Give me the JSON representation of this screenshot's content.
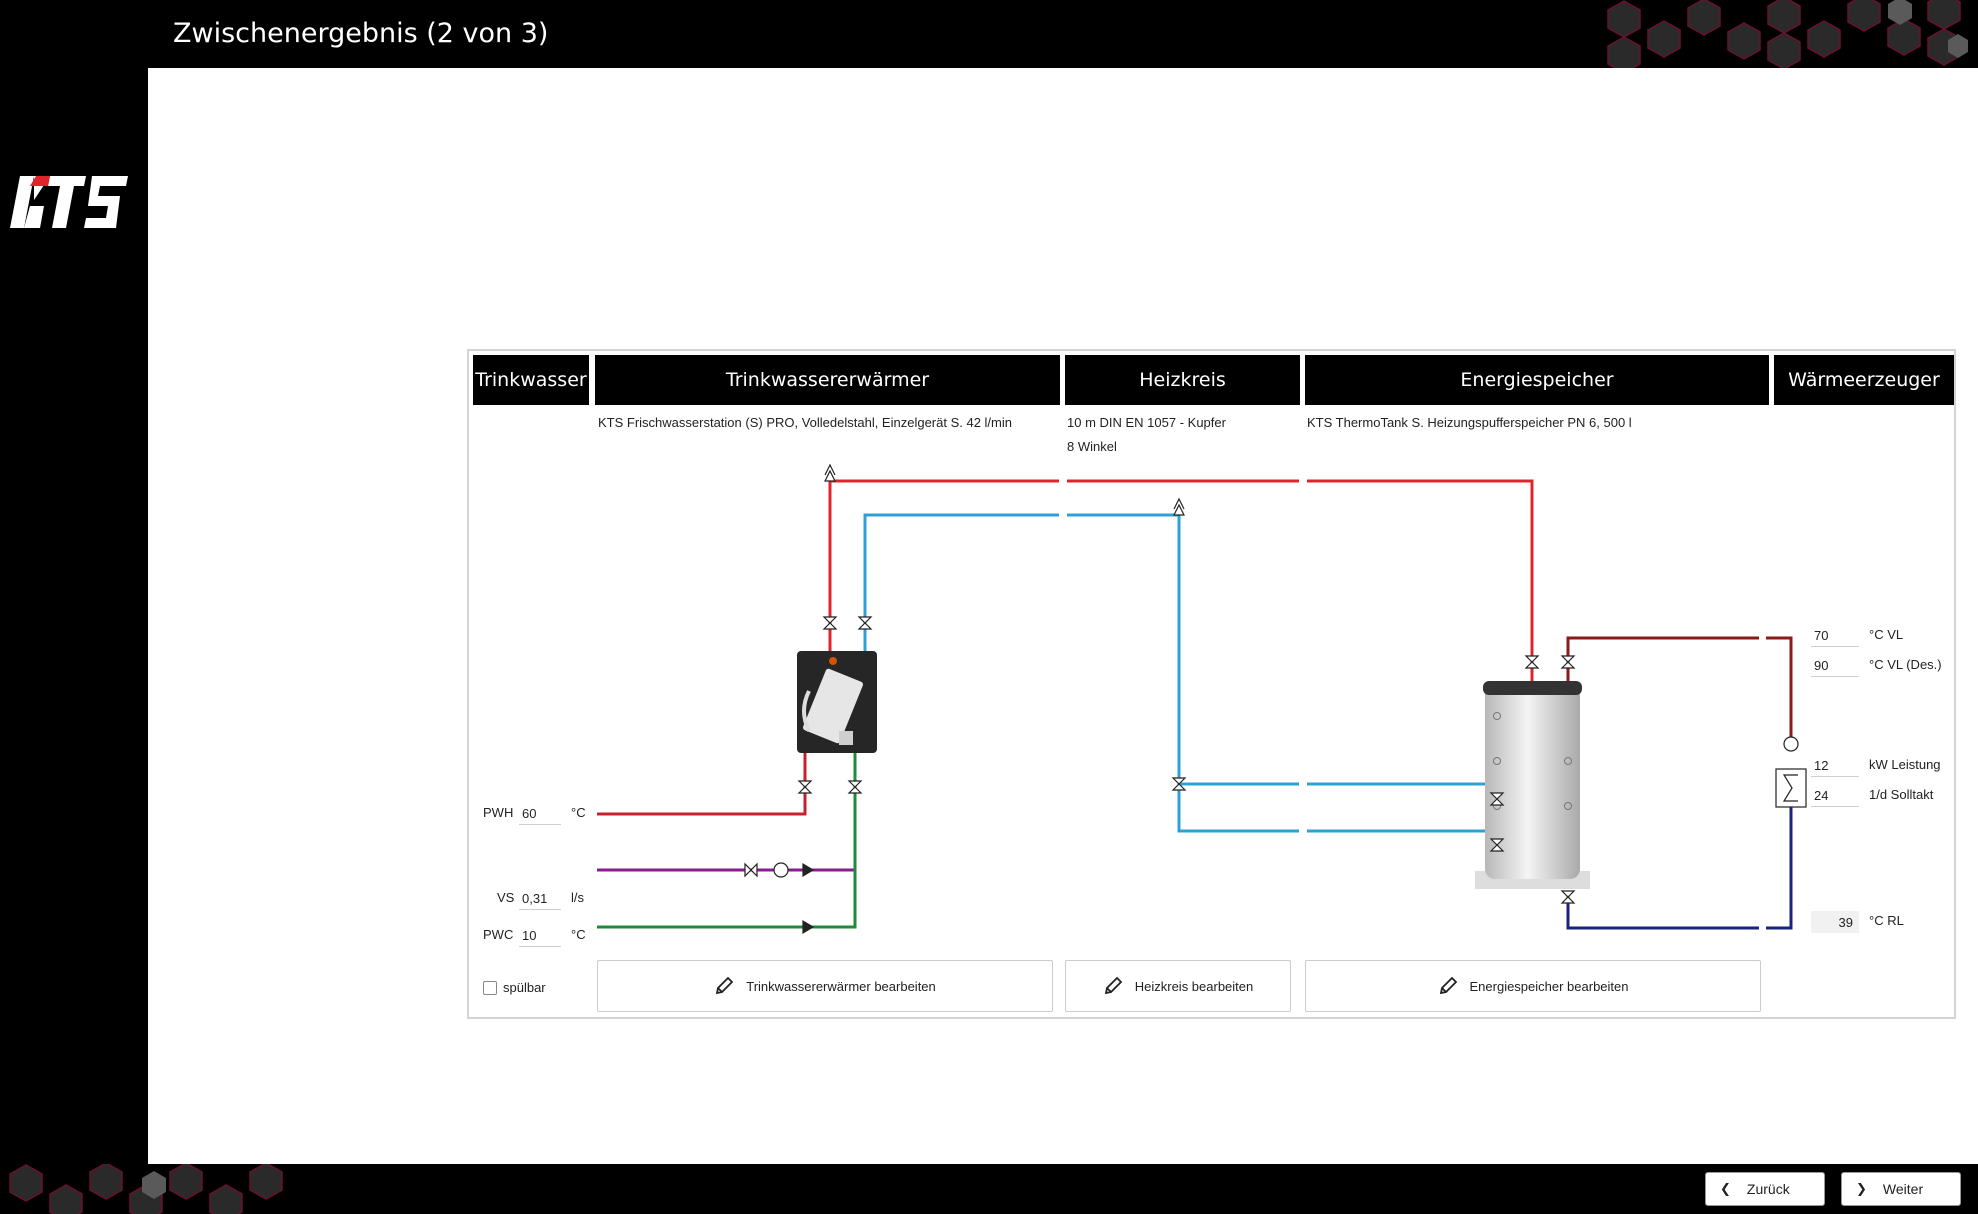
{
  "header": {
    "title": "Zwischenergebnis (2 von 3)"
  },
  "logo": {
    "text": "KTS"
  },
  "sections": [
    {
      "key": "trinkwasser",
      "label": "Trinkwasser"
    },
    {
      "key": "erwaermer",
      "label": "Trinkwassererwärmer"
    },
    {
      "key": "heizkreis",
      "label": "Heizkreis"
    },
    {
      "key": "speicher",
      "label": "Energiespeicher"
    },
    {
      "key": "erzeuger",
      "label": "Wärmeerzeuger"
    }
  ],
  "descriptions": {
    "erwaermer": "KTS Frischwasserstation (S) PRO, Volledelstahl,  Einzelgerät S. 42 l/min",
    "heizkreis_line1": "10 m DIN EN 1057 - Kupfer",
    "heizkreis_line2": "8 Winkel",
    "speicher": "KTS ThermoTank S. Heizungspufferspeicher PN 6,  500 l"
  },
  "trinkwasser_inputs": {
    "pwh": {
      "label": "PWH",
      "value": "60",
      "unit": "°C"
    },
    "vs": {
      "label": "VS",
      "value": "0,31",
      "unit": "l/s"
    },
    "pwc": {
      "label": "PWC",
      "value": "10",
      "unit": "°C"
    },
    "spuelbar": {
      "label": "spülbar",
      "checked": false
    }
  },
  "erzeuger_inputs": {
    "vl": {
      "value": "70",
      "unit": "°C VL"
    },
    "vl_des": {
      "value": "90",
      "unit": "°C VL (Des.)"
    },
    "leistung": {
      "value": "12",
      "unit": "kW Leistung"
    },
    "solltakt": {
      "value": "24",
      "unit": "1/d Solltakt"
    },
    "rl": {
      "value": "39",
      "unit": "°C RL"
    }
  },
  "buttons": {
    "edit_erwaermer": "Trinkwassererwärmer bearbeiten",
    "edit_heizkreis": "Heizkreis bearbeiten",
    "edit_speicher": "Energiespeicher bearbeiten",
    "back": "Zurück",
    "next": "Weiter"
  },
  "colors": {
    "hot": "#e0242c",
    "cold": "#2ea0d8",
    "pwh": "#c8202a",
    "circulation": "#8a1c8e",
    "pwc": "#1f8a3a",
    "generator_flow": "#8b1a1a",
    "generator_return": "#1a237e"
  }
}
